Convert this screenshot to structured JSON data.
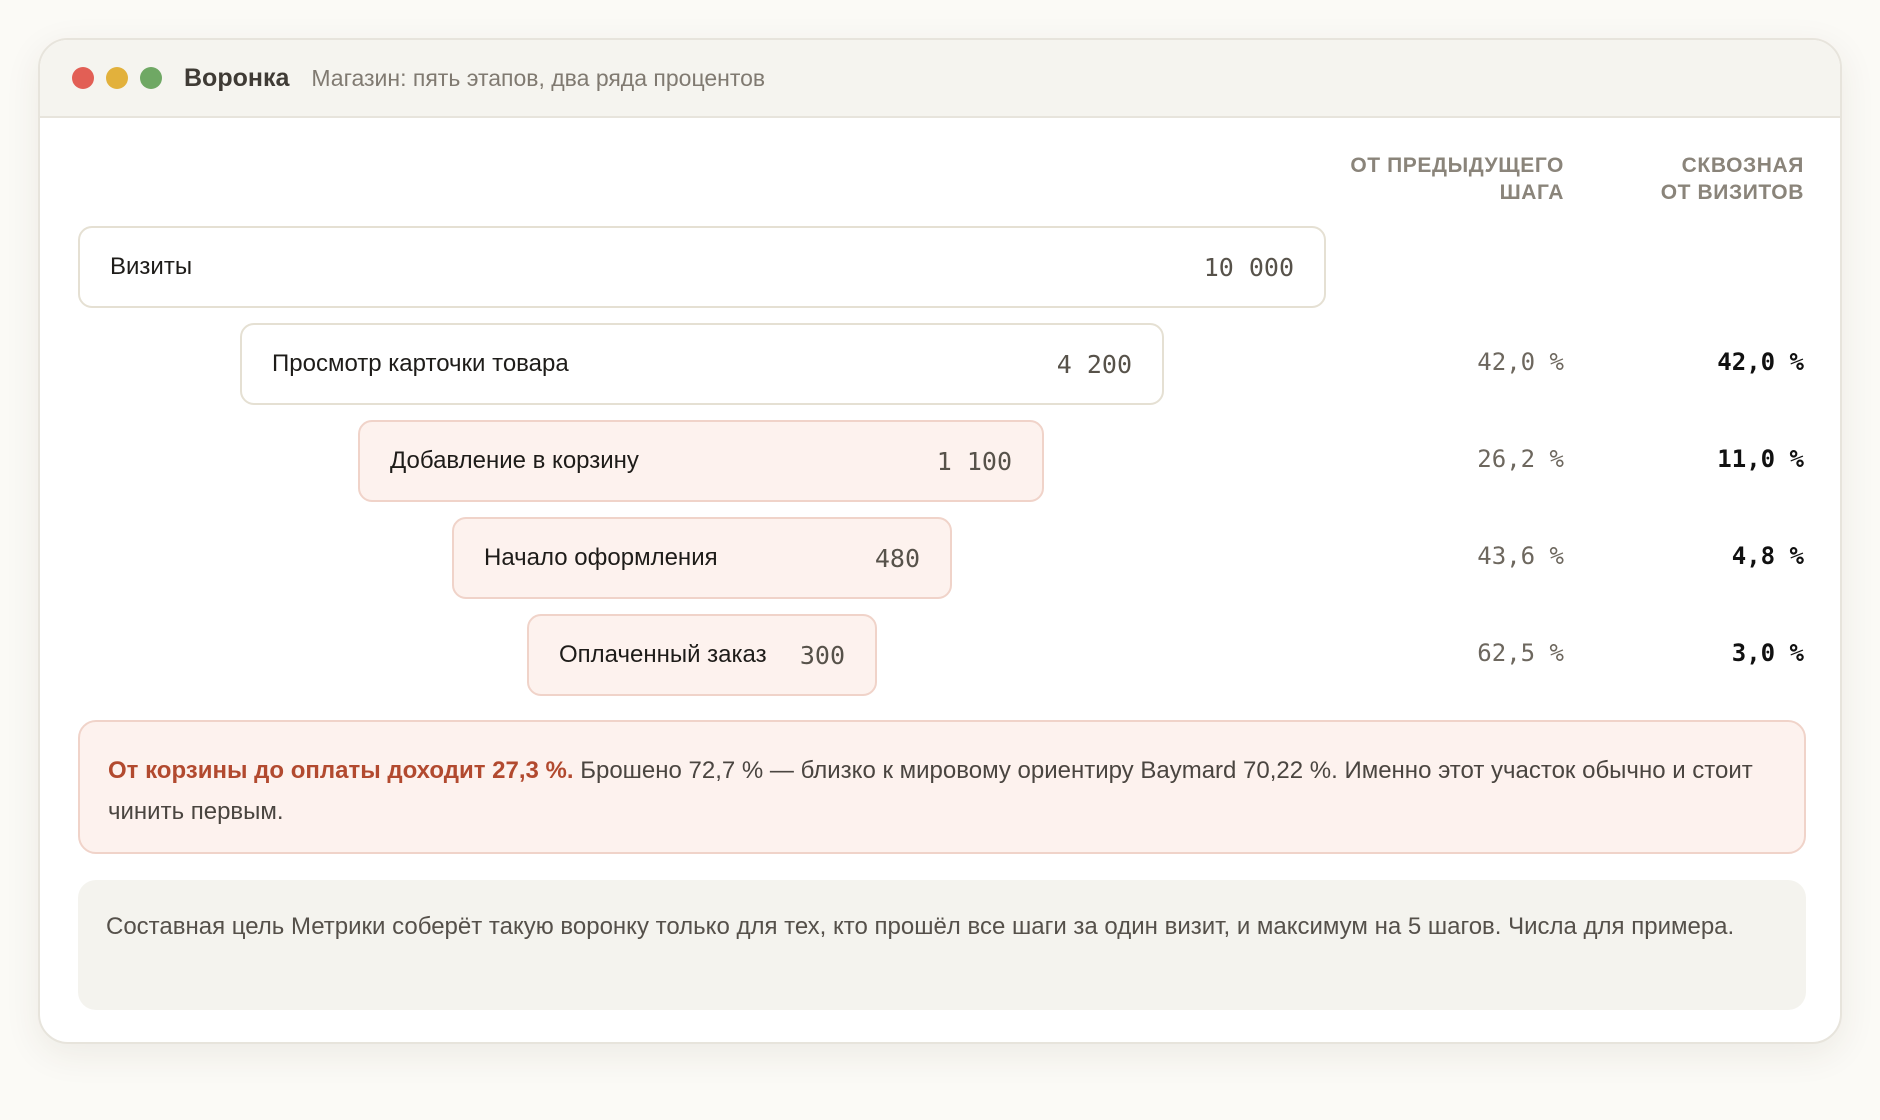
{
  "window": {
    "title": "Воронка",
    "subtitle": "Магазин: пять этапов, два ряда процентов"
  },
  "columns": {
    "prev_line1": "От предыдущего",
    "prev_line2": "шага",
    "total_line1": "Сквозная",
    "total_line2": "от визитов"
  },
  "funnel": [
    {
      "label": "Визиты",
      "value": "10 000",
      "prev_pct": "",
      "total_pct": ""
    },
    {
      "label": "Просмотр карточки товара",
      "value": "4 200",
      "prev_pct": "42,0 %",
      "total_pct": "42,0 %"
    },
    {
      "label": "Добавление в корзину",
      "value": "1 100",
      "prev_pct": "26,2 %",
      "total_pct": "11,0 %"
    },
    {
      "label": "Начало оформления",
      "value": "480",
      "prev_pct": "43,6 %",
      "total_pct": "4,8 %"
    },
    {
      "label": "Оплаченный заказ",
      "value": "300",
      "prev_pct": "62,5 %",
      "total_pct": "3,0 %"
    }
  ],
  "alert": {
    "strong": "От корзины до оплаты доходит 27,3 %.",
    "text": " Брошено 72,7 % — близко к мировому ориентиру Baymard 70,22 %. Именно этот участок обычно и стоит чинить первым."
  },
  "note": {
    "text": "Составная цель Метрики соберёт такую воронку только для тех, кто прошёл все шаги за один визит, и максимум на 5 шагов. Числа для примера."
  },
  "colors": {
    "accent": "#b24a2f",
    "drop_bg": "#fdf2ee",
    "drop_border": "#f0d3c9"
  }
}
